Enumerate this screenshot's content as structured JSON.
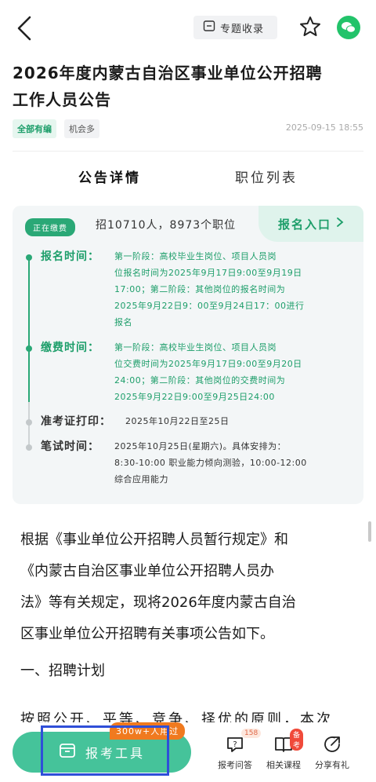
{
  "header": {
    "topic_label": "专题收录",
    "icons": [
      "back-icon",
      "folder-icon",
      "star-icon",
      "wechat-icon"
    ]
  },
  "article": {
    "title_line1": "2026年度内蒙古自治区事业单位公开招聘",
    "title_line2": "工作人员公告",
    "tag_all": "全部有编",
    "tag_chance": "机会多",
    "date": "2025-09-15  18:55"
  },
  "tabs": {
    "details": "公告详情",
    "positions": "职位列表"
  },
  "card": {
    "status": "正在缴费",
    "recruit": "招10710人，8973个职位",
    "entry_label": "报名入口",
    "registration": {
      "label": "报名时间：",
      "lines": [
        "第一阶段：高校毕业生岗位、项目人员岗",
        "位报名时间为2025年9月17日9:00至9月19日",
        "17:00；第二阶段：其他岗位的报名时间为",
        "2025年9月22日9：00至9月24日17：00进行",
        "报名"
      ]
    },
    "payment": {
      "label": "缴费时间：",
      "lines": [
        "第一阶段：高校毕业生岗位、项目人员岗",
        "位交费时间为2025年9月17日9:00至9月20日",
        "24:00；第二阶段：其他岗位的交费时间为",
        "2025年9月22日9:00至9月25日24:00"
      ]
    },
    "admission": {
      "label": "准考证打印：",
      "text": "2025年10月22日至25日"
    },
    "exam": {
      "label": "笔试时间：",
      "lines": [
        "2025年10月25日(星期六)。具体安排为：",
        "8:30-10:00 职业能力倾向测验，10:00-12:00",
        "综合应用能力"
      ]
    }
  },
  "body": {
    "para_lines": [
      "根据《事业单位公开招聘人员暂行规定》和",
      "《内蒙古自治区事业单位公开招聘人员办",
      "法》等有关规定，现将2026年度内蒙古自治",
      "区事业单位公开招聘有关事项公告如下。"
    ],
    "section1": "一、招聘计划",
    "cut_line": "按照公开、平等、竞争、择优的原则，本次"
  },
  "bottom": {
    "tool_label": "报考工具",
    "users_badge": "300w+人用过",
    "qa_label": "报考问答",
    "qa_count": "158",
    "course_label": "相关课程",
    "course_badge": "备考",
    "share_label": "分享有礼"
  },
  "colors": {
    "accent": "#2aa876",
    "accent_light": "#dff3ec",
    "orange": "#f07a1f",
    "highlight": "#2f4fd8"
  }
}
